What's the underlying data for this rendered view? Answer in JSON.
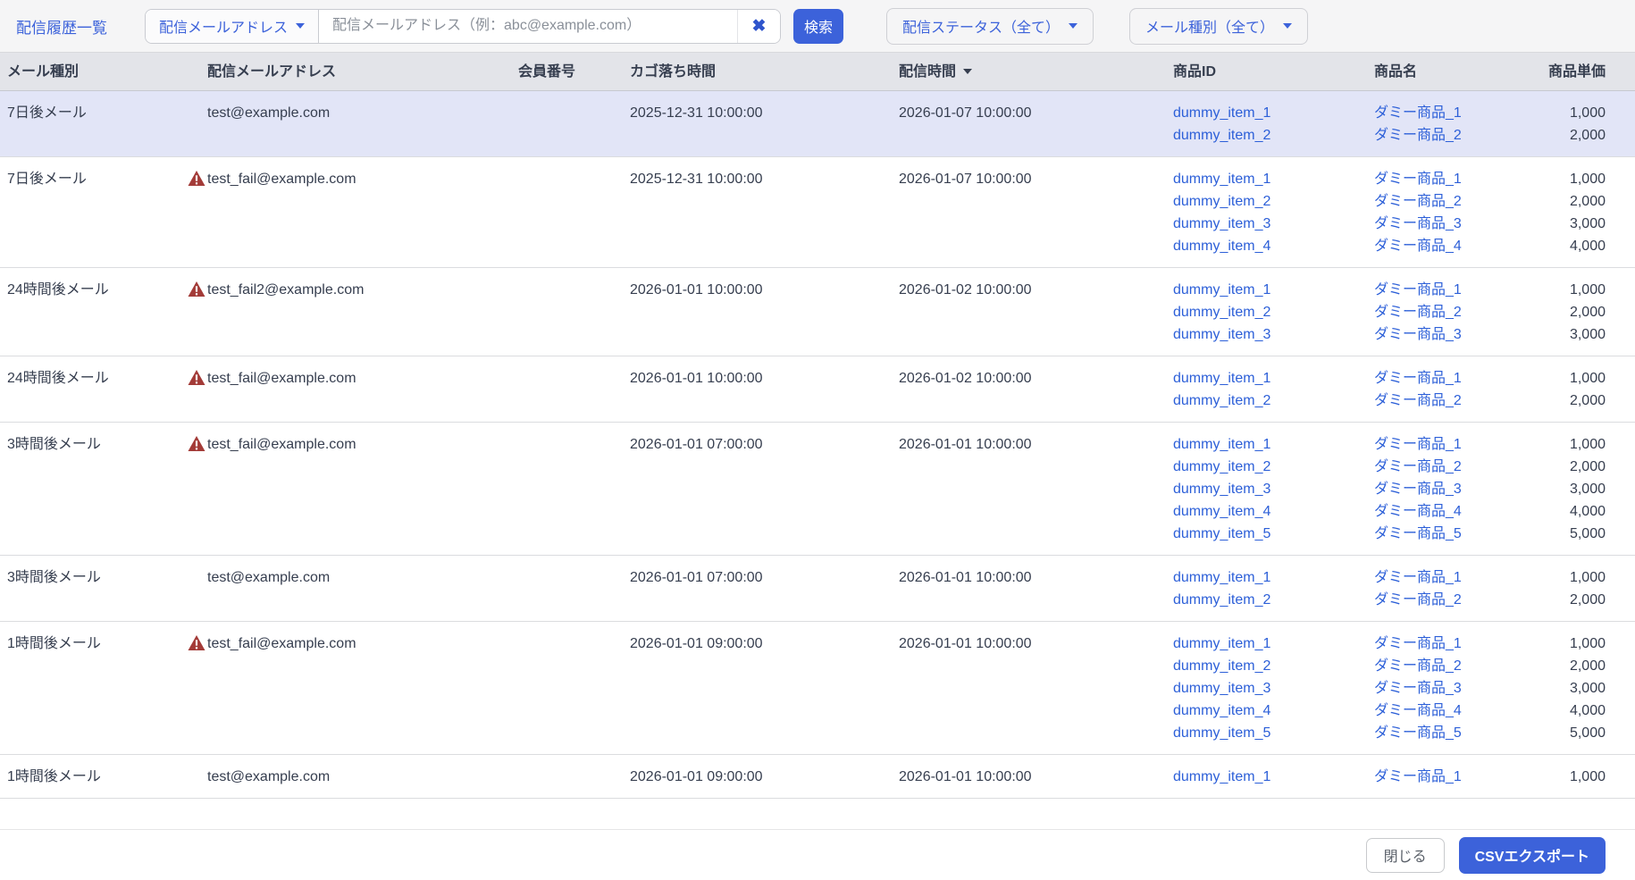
{
  "page": {
    "title": "配信履歴一覧"
  },
  "toolbar": {
    "field_selector_label": "配信メールアドレス",
    "search_placeholder": "配信メールアドレス（例：abc@example.com）",
    "search_value": "",
    "clear_label": "✖",
    "search_button_label": "検索",
    "status_filter_label": "配信ステータス（全て）",
    "mailtype_filter_label": "メール種別（全て）"
  },
  "table": {
    "columns": [
      "メール種別",
      "配信メールアドレス",
      "会員番号",
      "カゴ落ち時間",
      "配信時間",
      "商品ID",
      "商品名",
      "商品単価"
    ],
    "sort": {
      "column": "配信時間",
      "direction": "desc"
    },
    "rows": [
      {
        "mail_type": "7日後メール",
        "email": "test@example.com",
        "failed": false,
        "highlighted": true,
        "member_no": "",
        "cart_abandon_time": "2025-12-31 10:00:00",
        "delivery_time": "2026-01-07 10:00:00",
        "items": [
          {
            "id": "dummy_item_1",
            "name": "ダミー商品_1",
            "price": "1,000"
          },
          {
            "id": "dummy_item_2",
            "name": "ダミー商品_2",
            "price": "2,000"
          }
        ]
      },
      {
        "mail_type": "7日後メール",
        "email": "test_fail@example.com",
        "failed": true,
        "highlighted": false,
        "member_no": "",
        "cart_abandon_time": "2025-12-31 10:00:00",
        "delivery_time": "2026-01-07 10:00:00",
        "items": [
          {
            "id": "dummy_item_1",
            "name": "ダミー商品_1",
            "price": "1,000"
          },
          {
            "id": "dummy_item_2",
            "name": "ダミー商品_2",
            "price": "2,000"
          },
          {
            "id": "dummy_item_3",
            "name": "ダミー商品_3",
            "price": "3,000"
          },
          {
            "id": "dummy_item_4",
            "name": "ダミー商品_4",
            "price": "4,000"
          }
        ]
      },
      {
        "mail_type": "24時間後メール",
        "email": "test_fail2@example.com",
        "failed": true,
        "highlighted": false,
        "member_no": "",
        "cart_abandon_time": "2026-01-01 10:00:00",
        "delivery_time": "2026-01-02 10:00:00",
        "items": [
          {
            "id": "dummy_item_1",
            "name": "ダミー商品_1",
            "price": "1,000"
          },
          {
            "id": "dummy_item_2",
            "name": "ダミー商品_2",
            "price": "2,000"
          },
          {
            "id": "dummy_item_3",
            "name": "ダミー商品_3",
            "price": "3,000"
          }
        ]
      },
      {
        "mail_type": "24時間後メール",
        "email": "test_fail@example.com",
        "failed": true,
        "highlighted": false,
        "member_no": "",
        "cart_abandon_time": "2026-01-01 10:00:00",
        "delivery_time": "2026-01-02 10:00:00",
        "items": [
          {
            "id": "dummy_item_1",
            "name": "ダミー商品_1",
            "price": "1,000"
          },
          {
            "id": "dummy_item_2",
            "name": "ダミー商品_2",
            "price": "2,000"
          }
        ]
      },
      {
        "mail_type": "3時間後メール",
        "email": "test_fail@example.com",
        "failed": true,
        "highlighted": false,
        "member_no": "",
        "cart_abandon_time": "2026-01-01 07:00:00",
        "delivery_time": "2026-01-01 10:00:00",
        "items": [
          {
            "id": "dummy_item_1",
            "name": "ダミー商品_1",
            "price": "1,000"
          },
          {
            "id": "dummy_item_2",
            "name": "ダミー商品_2",
            "price": "2,000"
          },
          {
            "id": "dummy_item_3",
            "name": "ダミー商品_3",
            "price": "3,000"
          },
          {
            "id": "dummy_item_4",
            "name": "ダミー商品_4",
            "price": "4,000"
          },
          {
            "id": "dummy_item_5",
            "name": "ダミー商品_5",
            "price": "5,000"
          }
        ]
      },
      {
        "mail_type": "3時間後メール",
        "email": "test@example.com",
        "failed": false,
        "highlighted": false,
        "member_no": "",
        "cart_abandon_time": "2026-01-01 07:00:00",
        "delivery_time": "2026-01-01 10:00:00",
        "items": [
          {
            "id": "dummy_item_1",
            "name": "ダミー商品_1",
            "price": "1,000"
          },
          {
            "id": "dummy_item_2",
            "name": "ダミー商品_2",
            "price": "2,000"
          }
        ]
      },
      {
        "mail_type": "1時間後メール",
        "email": "test_fail@example.com",
        "failed": true,
        "highlighted": false,
        "member_no": "",
        "cart_abandon_time": "2026-01-01 09:00:00",
        "delivery_time": "2026-01-01 10:00:00",
        "items": [
          {
            "id": "dummy_item_1",
            "name": "ダミー商品_1",
            "price": "1,000"
          },
          {
            "id": "dummy_item_2",
            "name": "ダミー商品_2",
            "price": "2,000"
          },
          {
            "id": "dummy_item_3",
            "name": "ダミー商品_3",
            "price": "3,000"
          },
          {
            "id": "dummy_item_4",
            "name": "ダミー商品_4",
            "price": "4,000"
          },
          {
            "id": "dummy_item_5",
            "name": "ダミー商品_5",
            "price": "5,000"
          }
        ]
      },
      {
        "mail_type": "1時間後メール",
        "email": "test@example.com",
        "failed": false,
        "highlighted": false,
        "member_no": "",
        "cart_abandon_time": "2026-01-01 09:00:00",
        "delivery_time": "2026-01-01 10:00:00",
        "items": [
          {
            "id": "dummy_item_1",
            "name": "ダミー商品_1",
            "price": "1,000"
          }
        ]
      }
    ]
  },
  "footer": {
    "close_button_label": "閉じる",
    "export_button_label": "CSVエクスポート"
  },
  "colors": {
    "accent_blue": "#3c62da",
    "link_blue": "#2c5fd8",
    "warning_red": "#a33b38",
    "highlight_row": "#e2e5f7",
    "header_bg": "#e3e4e9",
    "topbar_bg": "#f5f5f6",
    "text_dark": "#363e4f"
  }
}
